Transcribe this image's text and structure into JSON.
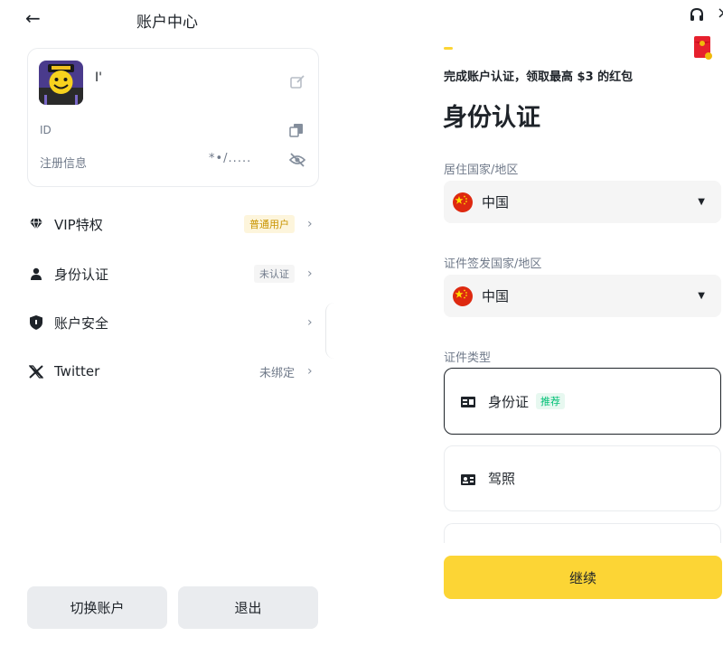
{
  "left": {
    "header": {
      "back_icon": "arrow-left-icon",
      "title": "账户中心"
    },
    "profile": {
      "username": "I'",
      "id_label": "ID",
      "register_label": "注册信息",
      "register_value": "*•/.....",
      "icons": [
        "edit-icon",
        "copy-icon",
        "eye-off-icon"
      ]
    },
    "menu": [
      {
        "icon": "vip-diamond-icon",
        "label": "VIP特权",
        "badge": "普通用户",
        "badge_style": "vip"
      },
      {
        "icon": "person-icon",
        "label": "身份认证",
        "badge": "未认证",
        "badge_style": "grey"
      },
      {
        "icon": "shield-icon",
        "label": "账户安全",
        "badge": "",
        "badge_style": "none"
      },
      {
        "icon": "x-logo-icon",
        "label": "Twitter",
        "badge": "未绑定",
        "badge_style": "plain"
      }
    ],
    "buttons": {
      "switch_account": "切换账户",
      "logout": "退出"
    }
  },
  "right": {
    "top_icons": [
      "headset-icon",
      "close-icon",
      "red-packet-icon"
    ],
    "progress_color": "#fcd535",
    "promo": "完成账户认证，领取最高 $3 的红包",
    "title": "身份认证",
    "residence": {
      "label": "居住国家/地区",
      "value": "中国",
      "flag": "china-flag-icon"
    },
    "issuing": {
      "label": "证件签发国家/地区",
      "value": "中国",
      "flag": "china-flag-icon"
    },
    "doc_type_label": "证件类型",
    "doc_types": [
      {
        "icon": "id-card-icon",
        "label": "身份证",
        "tag": "推荐",
        "selected": true
      },
      {
        "icon": "license-icon",
        "label": "驾照",
        "tag": "",
        "selected": false
      }
    ],
    "continue_button": "继续"
  },
  "colors": {
    "brand_yellow": "#fcd535",
    "text": "#1e2329",
    "muted": "#707a8a",
    "recommend_green": "#02c076"
  }
}
